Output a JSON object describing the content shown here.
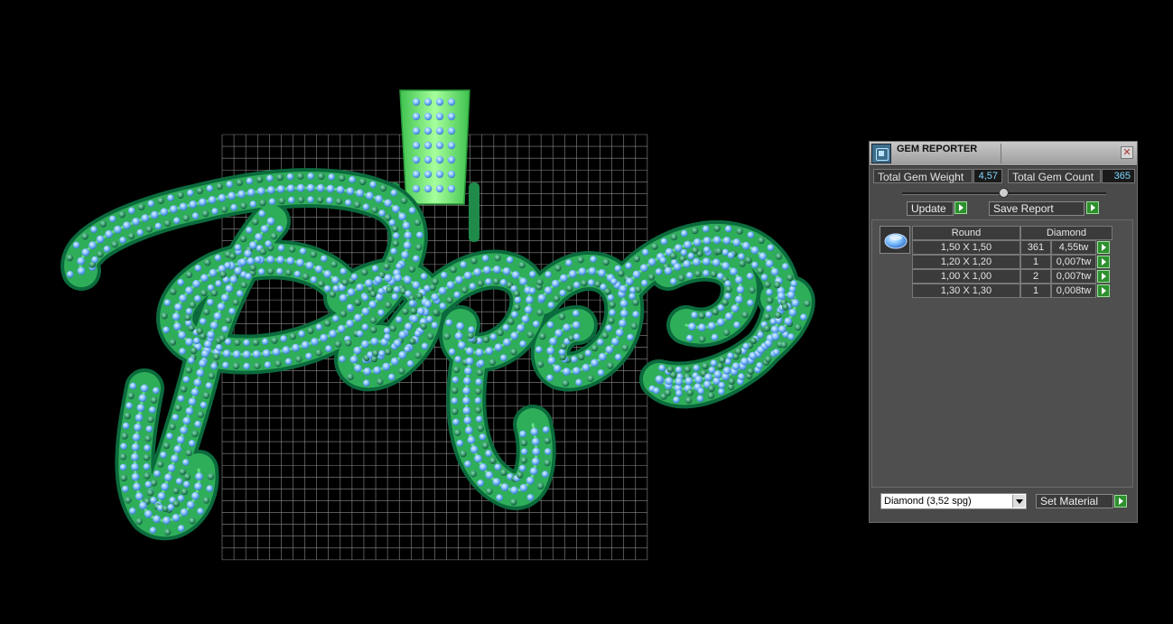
{
  "panel": {
    "title": "GEM REPORTER",
    "close_glyph": "✕",
    "total_weight_label": "Total Gem Weight",
    "total_weight_value": "4,57",
    "total_count_label": "Total Gem Count",
    "total_count_value": "365",
    "update_label": "Update",
    "save_report_label": "Save Report",
    "table": {
      "headers": [
        "Round",
        "Diamond"
      ],
      "rows": [
        {
          "size": "1,50 X 1,50",
          "count": "361",
          "weight": "4,55tw"
        },
        {
          "size": "1,20 X 1,20",
          "count": "1",
          "weight": "0,007tw"
        },
        {
          "size": "1,00 X 1,00",
          "count": "2",
          "weight": "0,007tw"
        },
        {
          "size": "1,30 X 1,30",
          "count": "1",
          "weight": "0,008tw"
        }
      ]
    },
    "material_select_value": "Diamond    (3,52 spg)",
    "set_material_label": "Set Material"
  },
  "icons": {
    "app": "gem-reporter-icon",
    "close": "close-icon",
    "gem": "round-gem-icon",
    "go": "green-arrow-icon",
    "dropdown": "chevron-down-icon"
  },
  "colors": {
    "value_text": "#7fd8ff",
    "gem_blue": "#8cc8ff",
    "gem_green": "#0f7a4a",
    "metal_green": "#5de06a",
    "grid": "#8a8a8a"
  }
}
